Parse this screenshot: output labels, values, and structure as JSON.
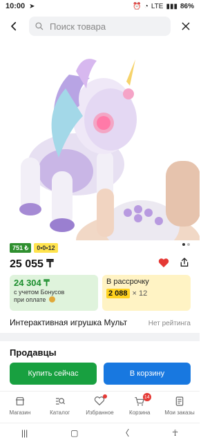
{
  "status": {
    "time": "10:00",
    "signal_label": "LTE",
    "battery": "86%"
  },
  "search": {
    "placeholder": "Поиск товара"
  },
  "product": {
    "badges": [
      "751 ₺",
      "0•0•12"
    ],
    "price": "25 055 ₸",
    "title": "Интерактивная игрушка Мульт",
    "rating": "Нет рейтинга"
  },
  "promo": {
    "bonus_price": "24 304 ₸",
    "bonus_note_line1": "с учетом Бонусов",
    "bonus_note_line2": "при оплате",
    "installment_title": "В рассрочку",
    "installment_amount": "2 088",
    "installment_mult": "× 12"
  },
  "sellers": {
    "title": "Продавцы"
  },
  "actions": {
    "buy_now": "Купить сейчас",
    "to_cart": "В корзину"
  },
  "bottom_nav": {
    "items": [
      {
        "label": "Магазин",
        "icon": "store-icon"
      },
      {
        "label": "Каталог",
        "icon": "catalog-icon"
      },
      {
        "label": "Избранное",
        "icon": "heart-icon"
      },
      {
        "label": "Корзина",
        "icon": "cart-icon",
        "count": "14"
      },
      {
        "label": "Мои заказы",
        "icon": "orders-icon"
      }
    ]
  },
  "colors": {
    "buy": "#18a040",
    "cart": "#1878e0",
    "accent_red": "#e53935"
  }
}
